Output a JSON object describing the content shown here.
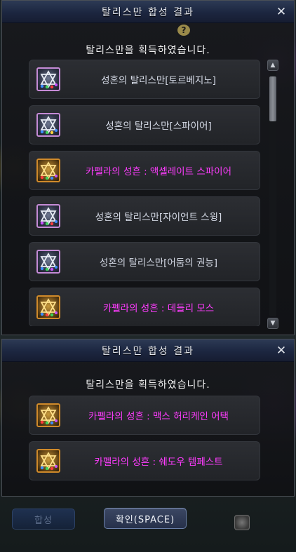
{
  "window1": {
    "title": "탈리스만 합성 결과",
    "close_label": "✕",
    "help_label": "?",
    "heading": "탈리스만을 획득하였습니다.",
    "items": [
      {
        "label": "성혼의 탈리스만[토르베지노]",
        "rarity": "silver"
      },
      {
        "label": "성혼의 탈리스만[스파이어]",
        "rarity": "silver"
      },
      {
        "label": "카펠라의 성흔 : 액셀레이트 스파이어",
        "rarity": "gold"
      },
      {
        "label": "성혼의 탈리스만[자이언트 스윙]",
        "rarity": "silver"
      },
      {
        "label": "성혼의 탈리스만[어둠의 권능]",
        "rarity": "silver"
      },
      {
        "label": "카펠라의 성흔 : 데들리 모스",
        "rarity": "gold"
      }
    ],
    "scroll_up_label": "▲",
    "scroll_down_label": "▼"
  },
  "window2": {
    "title": "탈리스만 합성 결과",
    "close_label": "✕",
    "heading": "탈리스만을 획득하였습니다.",
    "items": [
      {
        "label": "카펠라의 성흔 : 맥스 허리케인 어택",
        "rarity": "gold"
      },
      {
        "label": "카펠라의 성흔 : 쉐도우 템페스트",
        "rarity": "gold"
      }
    ]
  },
  "buttons": {
    "compose_label": "합성",
    "confirm_label": "확인(SPACE)"
  },
  "colors": {
    "silver_text": "#d6dbe7",
    "gold_text": "#ff3cff",
    "title_bar": "#1c2640"
  }
}
